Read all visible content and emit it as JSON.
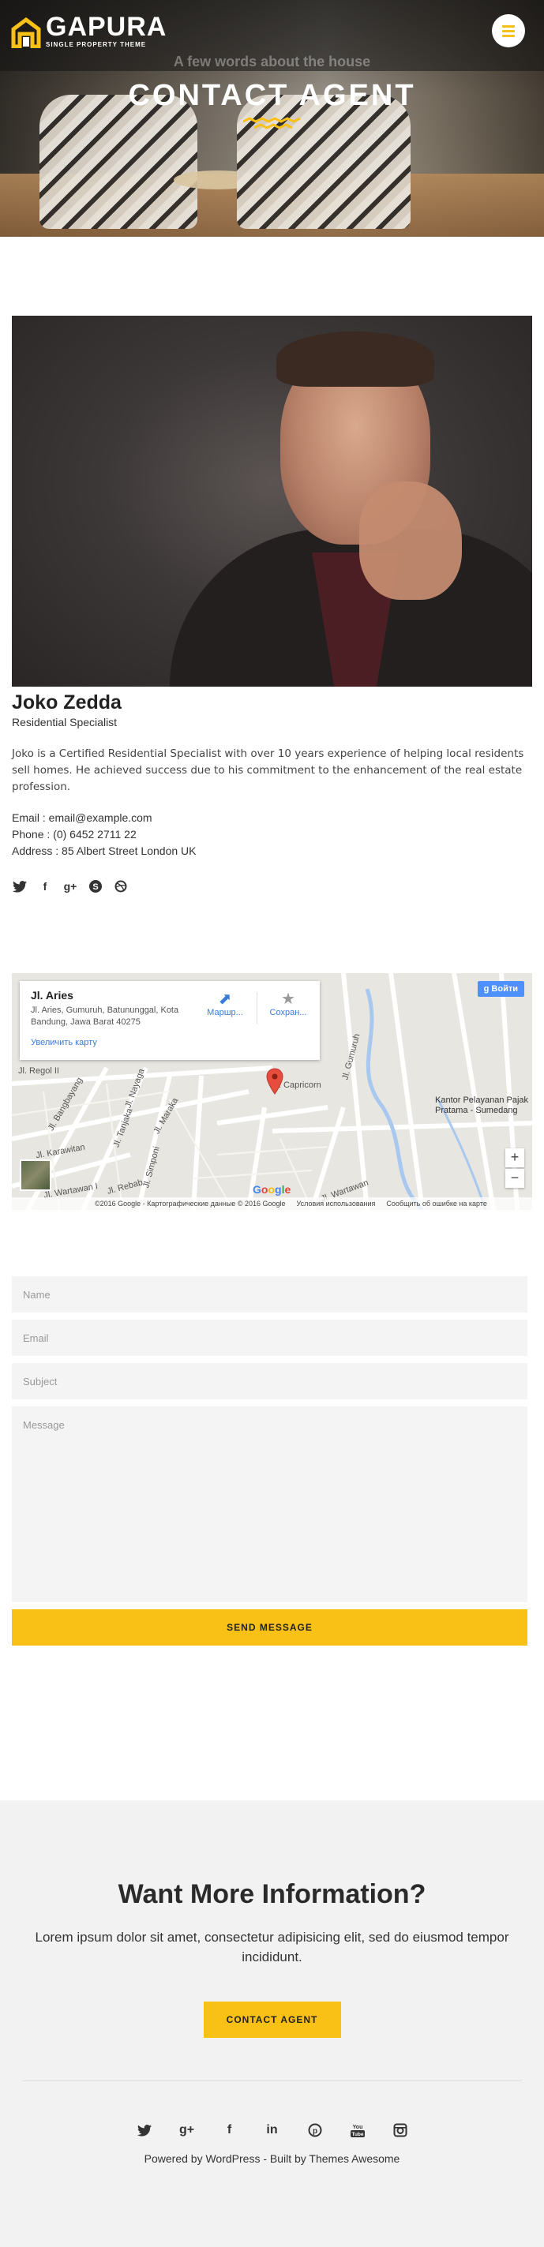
{
  "header": {
    "logo_name": "GAPURA",
    "logo_tagline": "SINGLE PROPERTY THEME",
    "menu_icon": "hamburger-icon"
  },
  "hero": {
    "kicker": "A few words about the house",
    "title": "CONTACT AGENT"
  },
  "agent": {
    "name": "Joko Zedda",
    "role": "Residential Specialist",
    "bio": "Joko is a Certified Residential Specialist with over 10 years experience of helping local residents sell homes. He achieved success due to his commitment to the enhancement of the real estate profession.",
    "email_line": "Email : email@example.com",
    "phone_line": "Phone : (0) 6452 2711 22",
    "address_line": "Address : 85 Albert Street London UK",
    "social": [
      "twitter-icon",
      "facebook-icon",
      "google-plus-icon",
      "skype-icon",
      "dribbble-icon"
    ]
  },
  "map": {
    "place_title": "Jl. Aries",
    "place_address": "Jl. Aries, Gumuruh, Batununggal, Kota Bandung, Jawa Barat 40275",
    "enlarge_link": "Увеличить карту",
    "route_label": "Маршр...",
    "save_label": "Сохран...",
    "signin_label": "Войти",
    "zoom_in": "+",
    "zoom_out": "−",
    "google_logo": "Google",
    "attribution": "©2016 Google - Картографические данные © 2016 Google",
    "terms": "Условия использования",
    "report": "Сообщить об ошибке на карте",
    "street_labels": [
      "Jl. Regol II",
      "Jl. Nayaga",
      "Jl. Karawitan",
      "Jl. Bangbayang",
      "Jl. Capricorn",
      "Jl. Gumuruh",
      "Jl. Wartawan I",
      "Jl. Simponi",
      "Jl. Maraka",
      "Jl. Tanjaka",
      "Jl. Rebab",
      "Jl. Wartawan"
    ],
    "place_label": "Kantor Pelayanan Pajak Pratama - Sumedang"
  },
  "form": {
    "name_placeholder": "Name",
    "email_placeholder": "Email",
    "subject_placeholder": "Subject",
    "message_placeholder": "Message",
    "send_label": "SEND MESSAGE"
  },
  "info": {
    "title": "Want More Information?",
    "text": "Lorem ipsum dolor sit amet, consectetur adipisicing elit, sed do eiusmod tempor incididunt.",
    "button_label": "CONTACT AGENT"
  },
  "footer": {
    "social": [
      "twitter-icon",
      "google-plus-icon",
      "facebook-icon",
      "linkedin-icon",
      "pinterest-icon",
      "youtube-icon",
      "instagram-icon"
    ],
    "powered": "Powered by WordPress - Built by Themes Awesome"
  },
  "colors": {
    "accent": "#f9c016",
    "info_bg": "#f2f2f2",
    "map_link": "#3a7bd5"
  }
}
